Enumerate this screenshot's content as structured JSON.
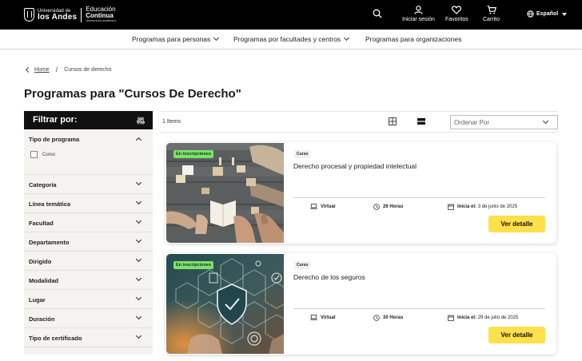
{
  "header": {
    "logo": {
      "university_line1": "Universidad de",
      "university_line2": "los Andes",
      "ec_line1": "Educación",
      "ec_line2": "Continua",
      "ec_line3": "Vicerrectoría académica"
    },
    "actions": {
      "login": "Iniciar sesión",
      "favorites": "Favoritos",
      "cart": "Carrito",
      "language": "Español"
    }
  },
  "nav": {
    "items": [
      {
        "label": "Programas para personas",
        "has_dropdown": true
      },
      {
        "label": "Programas por facultades y centros",
        "has_dropdown": true
      },
      {
        "label": "Programas para organizaciones",
        "has_dropdown": false
      }
    ]
  },
  "breadcrumb": {
    "home": "Home",
    "separator": "/",
    "current": "Cursos de derecho"
  },
  "page": {
    "title": "Programas para \"Cursos De Derecho\""
  },
  "filters": {
    "heading": "Filtrar por:",
    "groups": [
      {
        "label": "Tipo de programa",
        "expanded": true,
        "options": [
          {
            "label": "Curso",
            "checked": false
          }
        ]
      },
      {
        "label": "Categoría",
        "expanded": false
      },
      {
        "label": "Línea temática",
        "expanded": false
      },
      {
        "label": "Facultad",
        "expanded": false
      },
      {
        "label": "Departamento",
        "expanded": false
      },
      {
        "label": "Dirigido",
        "expanded": false
      },
      {
        "label": "Modalidad",
        "expanded": false
      },
      {
        "label": "Lugar",
        "expanded": false
      },
      {
        "label": "Duración",
        "expanded": false
      },
      {
        "label": "Tipo de certificado",
        "expanded": false
      }
    ]
  },
  "results": {
    "count": "1 Items",
    "sort": {
      "placeholder": "Ordenar Por"
    },
    "view_mode": "list",
    "cards": [
      {
        "status": "En inscripciones",
        "type": "Curso",
        "title": "Derecho procesal y propiedad intelectual",
        "mode": "Virtual",
        "duration": "26 Horas",
        "start_label": "Inicia el:",
        "start_date": "3 de junio de 2025",
        "cta": "Ver detalle"
      },
      {
        "status": "En inscripciones",
        "type": "Curso",
        "title": "Derecho de los seguros",
        "mode": "Virtual",
        "duration": "30 Horas",
        "start_label": "Inicia el:",
        "start_date": "29 de julio de 2025",
        "cta": "Ver detalle"
      }
    ]
  },
  "colors": {
    "header_bg": "#000000",
    "badge_green": "#7ee06e",
    "cta_yellow": "#fde04a",
    "sidebar_bg": "#f5f3f0"
  }
}
